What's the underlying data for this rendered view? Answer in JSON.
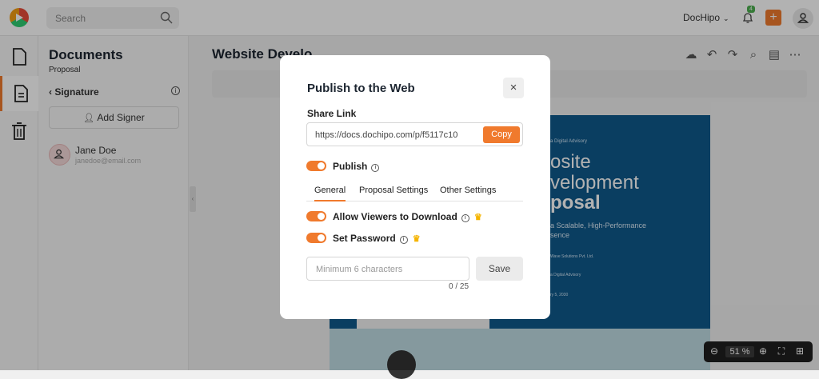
{
  "topbar": {
    "search_placeholder": "Search",
    "brand": "DocHipo",
    "notifications_count": "4",
    "add_label": "+"
  },
  "sidebar": {
    "title": "Documents",
    "subtitle": "Proposal",
    "section": "Signature",
    "add_signer": "Add Signer",
    "signer": {
      "name": "Jane Doe",
      "email": "janedoe@email.com"
    }
  },
  "editor": {
    "doc_title": "Website Develo",
    "cover": {
      "tag": "a Digital Advisory",
      "line1": "osite",
      "line2": "velopment",
      "line3": "posal",
      "tagline1": "a Scalable, High-Performance",
      "tagline2": "sence",
      "company": "Wave Solutions Pvt. Ltd.",
      "by": "a Digital Advisory",
      "date": "ry 5, 2030"
    },
    "zoom": {
      "value": "51",
      "unit": "%"
    }
  },
  "modal": {
    "title": "Publish to the Web",
    "share_link_label": "Share Link",
    "share_url": "https://docs.dochipo.com/p/f5117c10",
    "copy_label": "Copy",
    "publish_label": "Publish",
    "tabs": [
      "General",
      "Proposal Settings",
      "Other Settings"
    ],
    "allow_download_label": "Allow Viewers to Download",
    "set_password_label": "Set Password",
    "password_placeholder": "Minimum 6 characters",
    "password_counter": "0 / 25",
    "save_label": "Save",
    "close_glyph": "×"
  },
  "colors": {
    "accent": "#f07a2d",
    "cover_blue": "#0f5a8c"
  }
}
